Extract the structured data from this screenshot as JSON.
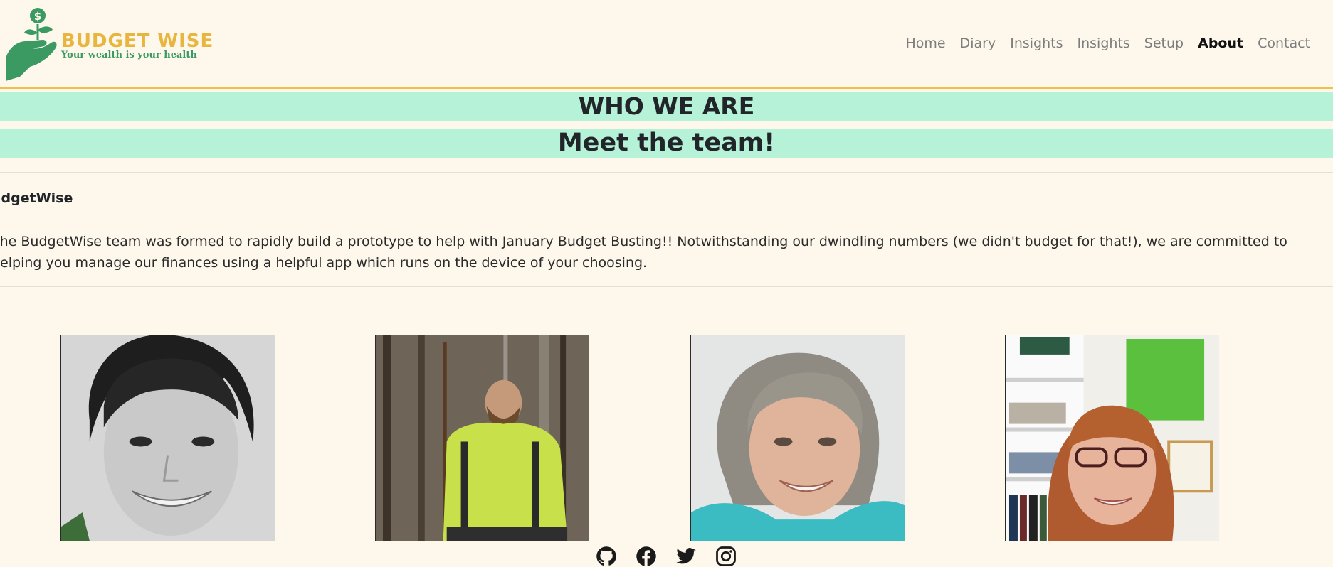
{
  "brand": {
    "title": "BUDGET WISE",
    "tagline": "Your wealth is your health",
    "logo_icon": "hand-holding-money-sprout-icon",
    "colors": {
      "title": "#e8b63e",
      "tagline": "#3a9a62",
      "hand": "#3a9a62"
    }
  },
  "nav": {
    "items": [
      {
        "label": "Home",
        "active": false
      },
      {
        "label": "Diary",
        "active": false
      },
      {
        "label": "Insights",
        "active": false
      },
      {
        "label": "Insights",
        "active": false
      },
      {
        "label": "Setup",
        "active": false
      },
      {
        "label": "About",
        "active": true
      },
      {
        "label": "Contact",
        "active": false
      }
    ]
  },
  "headings": {
    "who_we_are": "WHO WE ARE",
    "meet_team": "Meet the team!"
  },
  "about": {
    "title": "udgetWise",
    "body": "The BudgetWise team was formed to rapidly build a prototype to help with January Budget Busting!! Notwithstanding our dwindling numbers (we didn't budget for that!), we are committed to helping you manage our finances using a helpful app which runs on the device of your choosing."
  },
  "team": [
    {
      "photo": "team-member-1-photo",
      "description": "grayscale portrait, dark hair tied up, smiling"
    },
    {
      "photo": "team-member-2-photo",
      "description": "man in lime jacket with walking stick in forest"
    },
    {
      "photo": "team-member-3-photo",
      "description": "woman with grey hair, teal jacket, smiling"
    },
    {
      "photo": "team-member-4-photo",
      "description": "woman with auburn hair and glasses in office"
    }
  ],
  "social": [
    {
      "name": "github-icon"
    },
    {
      "name": "facebook-icon"
    },
    {
      "name": "twitter-icon"
    },
    {
      "name": "instagram-icon"
    }
  ],
  "colors": {
    "background": "#fef8ec",
    "accent_border": "#eec14a",
    "heading_band": "#b6f2d8"
  }
}
